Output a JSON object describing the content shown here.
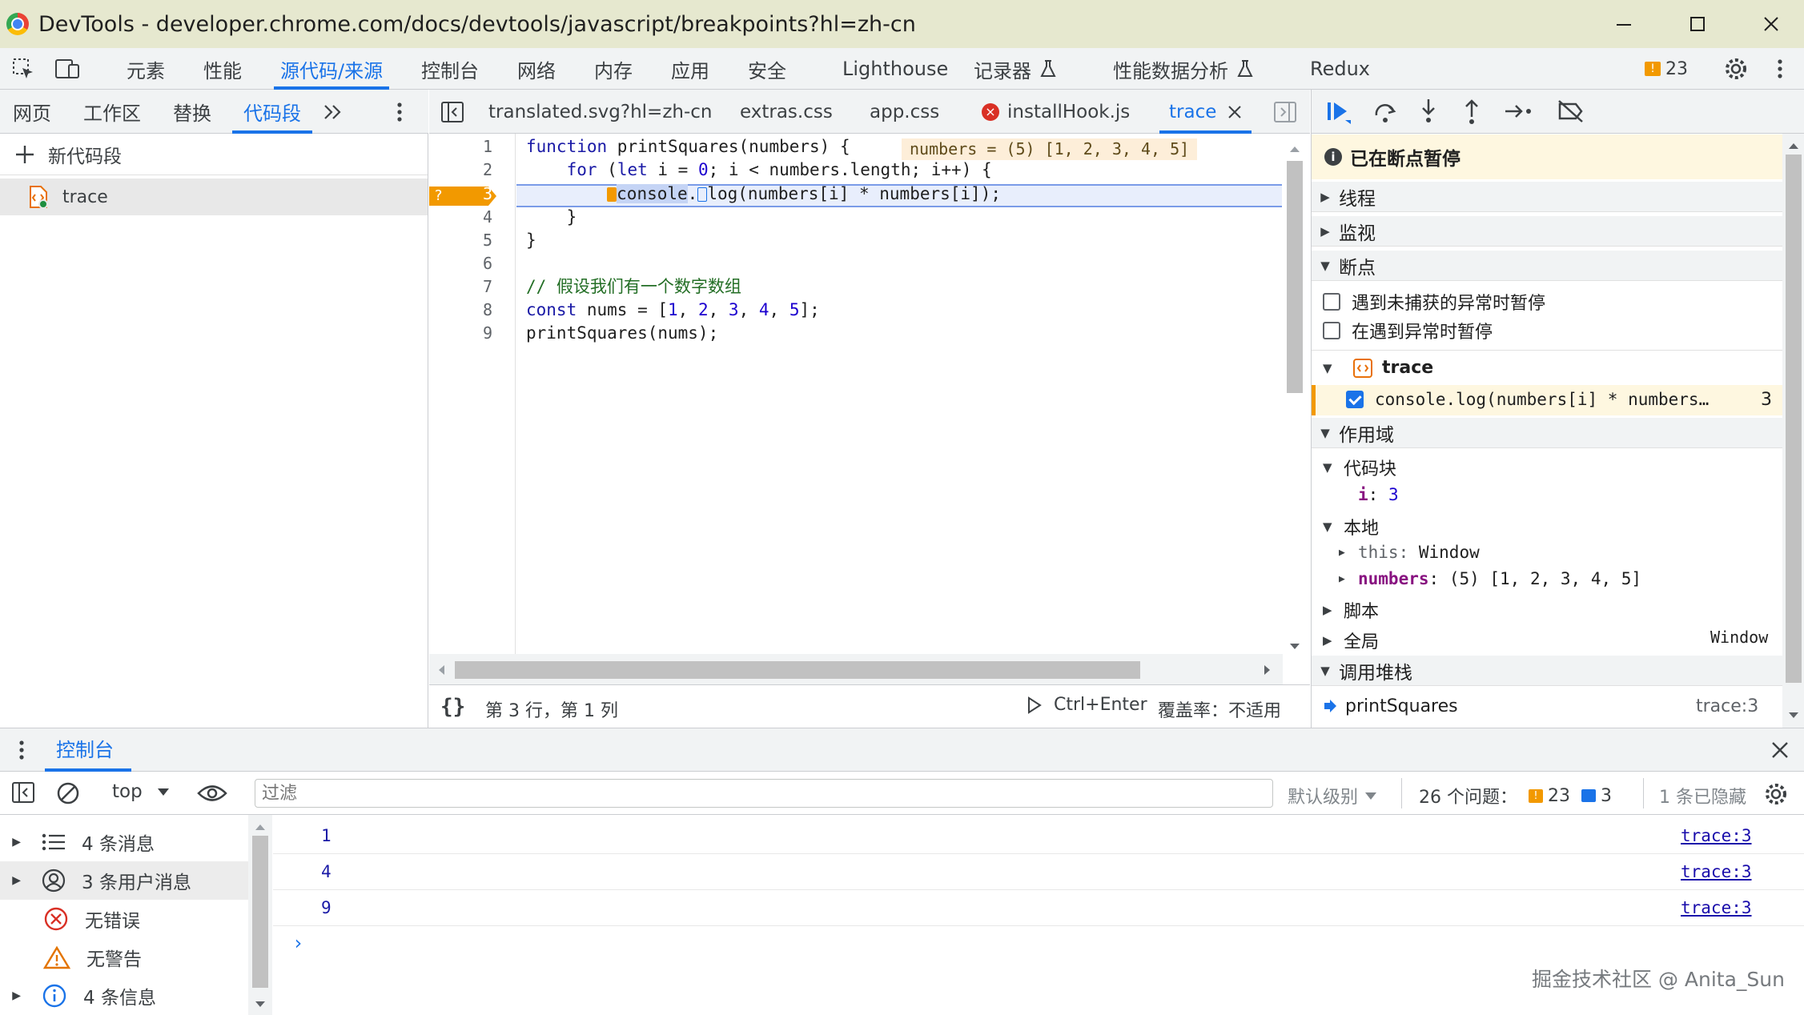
{
  "window": {
    "title": "DevTools - developer.chrome.com/docs/devtools/javascript/breakpoints?hl=zh-cn"
  },
  "main_tabs": [
    "元素",
    "性能",
    "源代码/来源",
    "控制台",
    "网络",
    "内存",
    "应用",
    "安全",
    "Lighthouse",
    "记录器",
    "性能数据分析",
    "Redux"
  ],
  "issues_count": "23",
  "nav_tabs": [
    "网页",
    "工作区",
    "替换",
    "代码段"
  ],
  "navigator": {
    "new_snippet": "新代码段",
    "snippet_name": "trace"
  },
  "editor_tabs": [
    "translated.svg?hl=zh-cn",
    "extras.css",
    "app.css",
    "installHook.js",
    "trace"
  ],
  "code": {
    "line_numbers": [
      "1",
      "2",
      "3",
      "4",
      "5",
      "6",
      "7",
      "8",
      "9"
    ],
    "inline_value": "numbers = (5) [1, 2, 3, 4, 5]",
    "bp_marker": "?"
  },
  "status": {
    "position": "第 3 行，第 1 列",
    "run": "Ctrl+Enter",
    "coverage": "覆盖率：不适用"
  },
  "debugger": {
    "paused_message": "已在断点暂停",
    "sections": {
      "threads": "线程",
      "watch": "监视",
      "breakpoints": "断点",
      "scope": "作用域",
      "callstack": "调用堆栈"
    },
    "pause_uncaught": "遇到未捕获的异常时暂停",
    "pause_caught": "在遇到异常时暂停",
    "bp_file": "trace",
    "bp_code": "console.log(numbers[i] * numbers…",
    "bp_line": "3",
    "scope": {
      "block": "代码块",
      "block_i_name": "i",
      "block_i_value": "3",
      "local": "本地",
      "this_name": "this",
      "this_value": "Window",
      "numbers_name": "numbers",
      "numbers_value": "(5) [1, 2, 3, 4, 5]",
      "script": "脚本",
      "global": "全局",
      "global_value": "Window"
    },
    "callstack_fn": "printSquares",
    "callstack_loc": "trace:3"
  },
  "drawer": {
    "tab": "控制台"
  },
  "console_toolbar": {
    "context": "top",
    "filter_placeholder": "过滤",
    "level": "默认级别",
    "issues_label": "26 个问题：",
    "warn_count": "23",
    "info_count": "3",
    "hidden": "1 条已隐藏"
  },
  "console_sidebar": [
    "4 条消息",
    "3 条用户消息",
    "无错误",
    "无警告",
    "4 条信息"
  ],
  "console_messages": [
    {
      "text": "1",
      "source": "trace:3"
    },
    {
      "text": "4",
      "source": "trace:3"
    },
    {
      "text": "9",
      "source": "trace:3"
    }
  ],
  "prompt": "›",
  "watermark": "掘金技术社区 @ Anita_Sun"
}
